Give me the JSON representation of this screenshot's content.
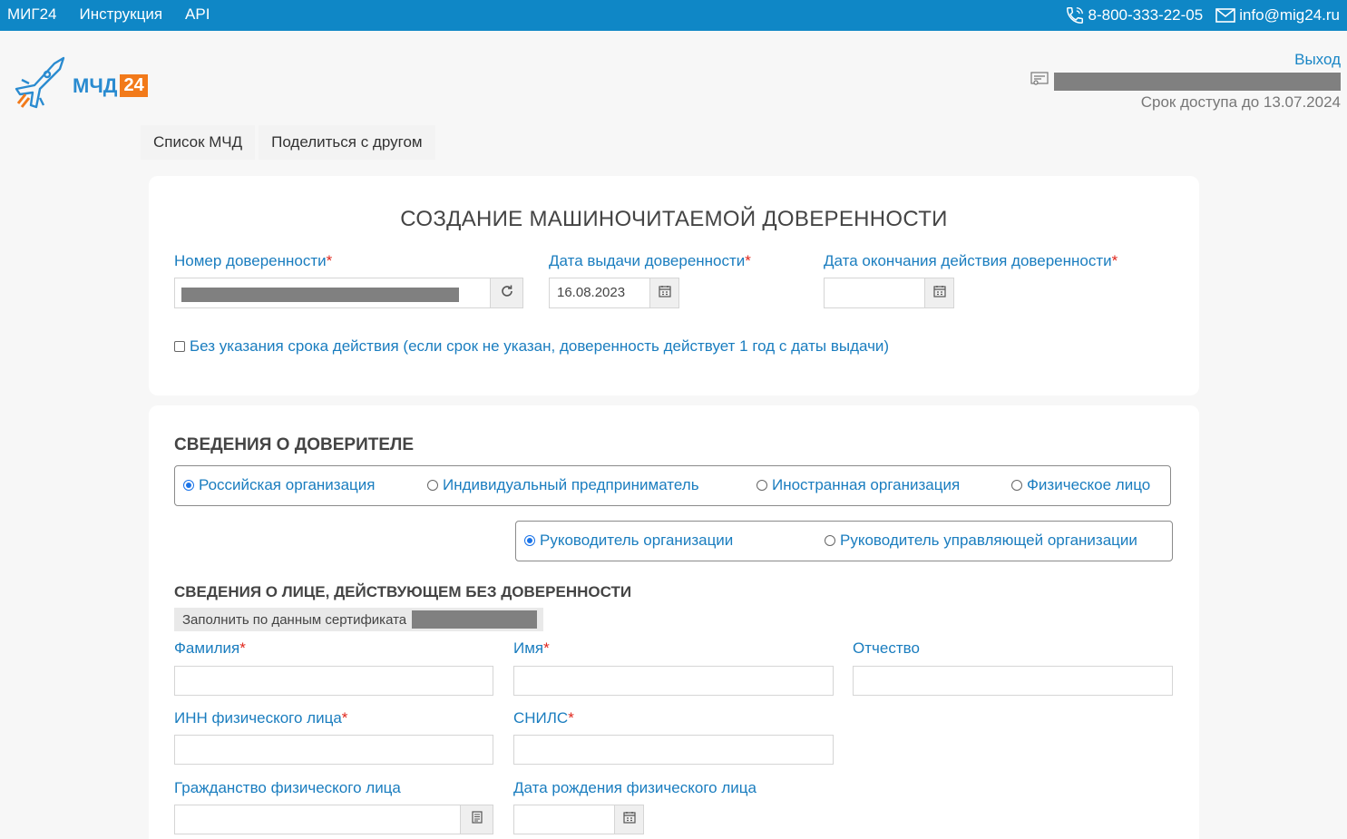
{
  "header": {
    "nav": [
      "МИГ24",
      "Инструкция",
      "API"
    ],
    "phone": "8-800-333-22-05",
    "email": "info@mig24.ru",
    "phone_icon": "phone-icon",
    "email_icon": "envelope-icon"
  },
  "logo": {
    "text": "МЧД",
    "badge": "24"
  },
  "user": {
    "logout": "Выход",
    "access": "Срок доступа до 13.07.2024",
    "icon": "certificate-icon"
  },
  "tabs": [
    "Список МЧД",
    "Поделиться с другом"
  ],
  "form": {
    "title": "СОЗДАНИЕ МАШИНОЧИТАЕМОЙ ДОВЕРЕННОСТИ",
    "number_label": "Номер доверенности",
    "issue_date_label": "Дата выдачи доверенности",
    "issue_date_value": "16.08.2023",
    "end_date_label": "Дата окончания действия доверенности",
    "end_date_value": "",
    "no_term_label": "Без указания срока действия (если срок не указан, доверенность действует 1 год с даты выдачи)",
    "required_mark": "*"
  },
  "principal": {
    "heading": "СВЕДЕНИЯ О ДОВЕРИТЕЛЕ",
    "types": [
      "Российская организация",
      "Индивидуальный предприниматель",
      "Иностранная организация",
      "Физическое лицо"
    ],
    "selected_type": "Российская организация",
    "roles": [
      "Руководитель организации",
      "Руководитель управляющей организации"
    ],
    "selected_role": "Руководитель организации",
    "person_heading": "СВЕДЕНИЯ О ЛИЦЕ, ДЕЙСТВУЮЩЕМ БЕЗ ДОВЕРЕННОСТИ",
    "fill_button": "Заполнить по данным сертификата",
    "surname_label": "Фамилия",
    "name_label": "Имя",
    "patronymic_label": "Отчество",
    "inn_label": "ИНН физического лица",
    "snils_label": "СНИЛС",
    "citizenship_label": "Гражданство физического лица",
    "birthdate_label": "Дата рождения физического лица"
  },
  "colors": {
    "topbar": "#0f87c6",
    "link": "#1a7dbf",
    "required": "#e0261c",
    "brand_orange": "#f27a1a"
  }
}
